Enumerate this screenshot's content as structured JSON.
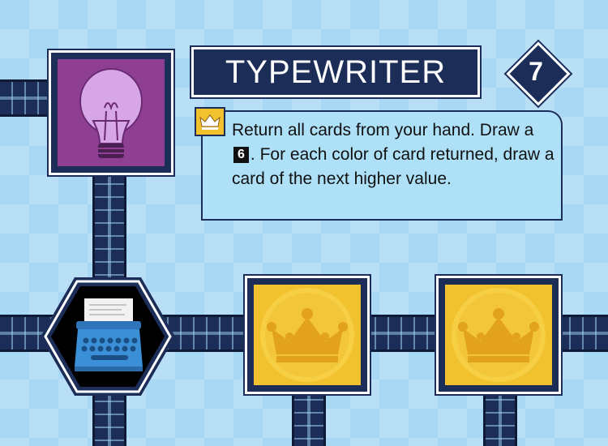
{
  "card": {
    "title": "TYPEWRITER",
    "age": "7"
  },
  "dogma": {
    "icon": "crown-icon",
    "line_before_badge": "Return all cards from your hand. Draw a",
    "badge_value": "6",
    "line_after_badge": ". For each color of card returned, draw a card of the next higher value."
  },
  "icons": {
    "top_left": "lightbulb-icon",
    "bottom_left": "typewriter-icon",
    "bottom_middle": "crown-icon",
    "bottom_right": "crown-icon"
  },
  "colors": {
    "background": "#a9d8f5",
    "navy": "#1c2d57",
    "purple": "#8e3f92",
    "gold": "#f2c12e",
    "crown": "#e2a21d"
  }
}
